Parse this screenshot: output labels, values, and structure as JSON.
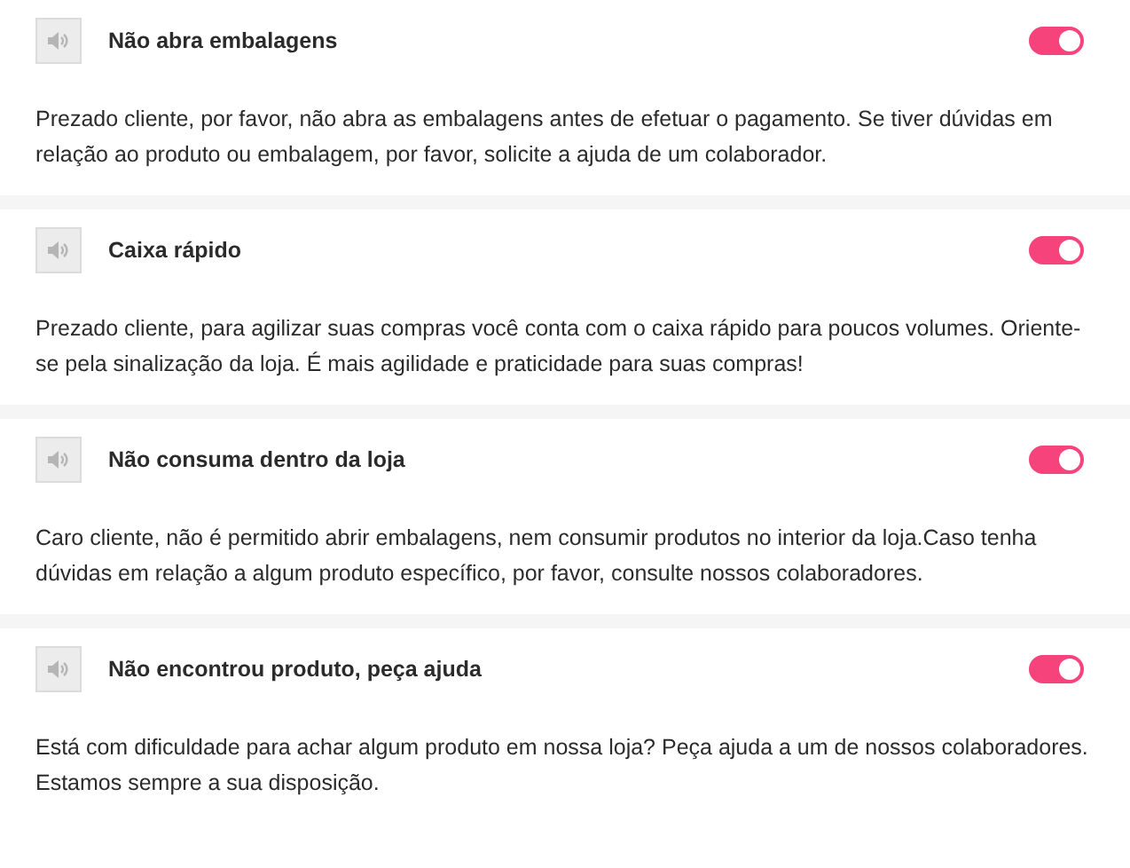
{
  "messages": [
    {
      "title": "Não abra embalagens",
      "on": true,
      "text": "Prezado cliente, por favor, não abra as embalagens antes de efetuar o pagamento. Se tiver dúvidas em relação ao produto ou embalagem, por favor, solicite a ajuda de um colaborador."
    },
    {
      "title": "Caixa rápido",
      "on": true,
      "text": "Prezado cliente, para agilizar suas compras você conta com o caixa rápido para poucos volumes. Oriente-se pela sinalização da loja. É mais agilidade e praticidade para suas compras!"
    },
    {
      "title": "Não consuma dentro da loja",
      "on": true,
      "text": "Caro cliente, não é permitido abrir embalagens, nem consumir produtos no interior da loja.Caso tenha dúvidas em relação a algum produto específico, por favor, consulte nossos colaboradores."
    },
    {
      "title": "Não encontrou produto, peça ajuda",
      "on": true,
      "text": "Está com dificuldade para achar algum produto em nossa loja? Peça ajuda a um de nossos colaboradores. Estamos sempre a sua disposição."
    }
  ]
}
